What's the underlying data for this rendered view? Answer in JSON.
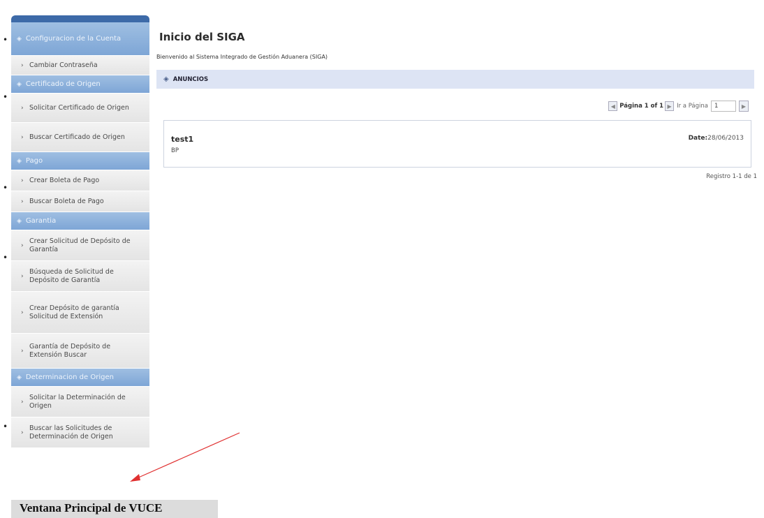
{
  "sidebar": {
    "sections": [
      {
        "header": "Configuracion de la Cuenta",
        "items": [
          "Cambiar Contraseña"
        ]
      },
      {
        "header": "Certificado de Origen",
        "items": [
          "Solicitar Certificado de Origen",
          "Buscar Certificado de Origen"
        ]
      },
      {
        "header": "Pago",
        "items": [
          "Crear Boleta de Pago",
          "Buscar Boleta de Pago"
        ]
      },
      {
        "header": "Garantia",
        "items": [
          "Crear Solicitud de Depósito de Garantía",
          "Búsqueda de Solicitud de Depósito de Garantía",
          "Crear Depósito de garantía Solicitud de Extensión",
          "Garantía de Depósito de Extensión Buscar"
        ]
      },
      {
        "header": "Determinacion de Origen",
        "items": [
          "Solicitar la Determinación de Origen",
          "Buscar las Solicitudes de Determinación de Origen"
        ]
      }
    ]
  },
  "main": {
    "title": "Inicio del SIGA",
    "subtitle": "Bienvenido al Sistema Integrado de Gestión Aduanera (SIGA)",
    "announcements_header": "ANUNCIOS",
    "pager": {
      "page_info": "Página 1 of 1",
      "goto_label": "Ir a Página",
      "page_input_value": "1"
    },
    "announcement": {
      "title": "test1",
      "body": "BP",
      "date_label": "Date:",
      "date_value": "28/06/2013"
    },
    "record_count": "Registro 1-1 de 1"
  },
  "caption": "Ventana Principal de VUCE",
  "colors": {
    "sidebar_header": "#8cb1dc",
    "sidebar_cap": "#3d6aa8",
    "menu_item_bg": "#ebebeb",
    "announce_bar": "#dde4f4",
    "annotation_arrow": "#e03030",
    "caption_bg": "#dcdcdc"
  }
}
